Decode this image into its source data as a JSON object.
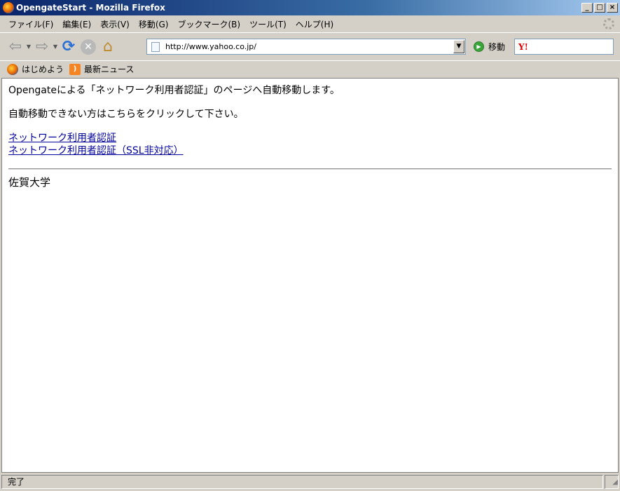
{
  "window": {
    "title": "OpengateStart - Mozilla Firefox",
    "minimize": "_",
    "maximize": "□",
    "close": "×"
  },
  "menu": {
    "items": [
      {
        "label": "ファイル(F)"
      },
      {
        "label": "編集(E)"
      },
      {
        "label": "表示(V)"
      },
      {
        "label": "移動(G)"
      },
      {
        "label": "ブックマーク(B)"
      },
      {
        "label": "ツール(T)"
      },
      {
        "label": "ヘルプ(H)"
      }
    ]
  },
  "toolbar": {
    "url": "http://www.yahoo.co.jp/",
    "go_label": "移動",
    "search_value": ""
  },
  "bookmarks": {
    "items": [
      {
        "label": "はじめよう",
        "icon": "firefox-icon"
      },
      {
        "label": "最新ニュース",
        "icon": "rss-icon"
      }
    ]
  },
  "page": {
    "line1": "Opengateによる「ネットワーク利用者認証」のページへ自動移動します。",
    "line2": "自動移動できない方はこちらをクリックして下さい。",
    "link1": "ネットワーク利用者認証",
    "link2": "ネットワーク利用者認証（SSL非対応）",
    "footer": "佐賀大学"
  },
  "status": {
    "text": "完了"
  }
}
